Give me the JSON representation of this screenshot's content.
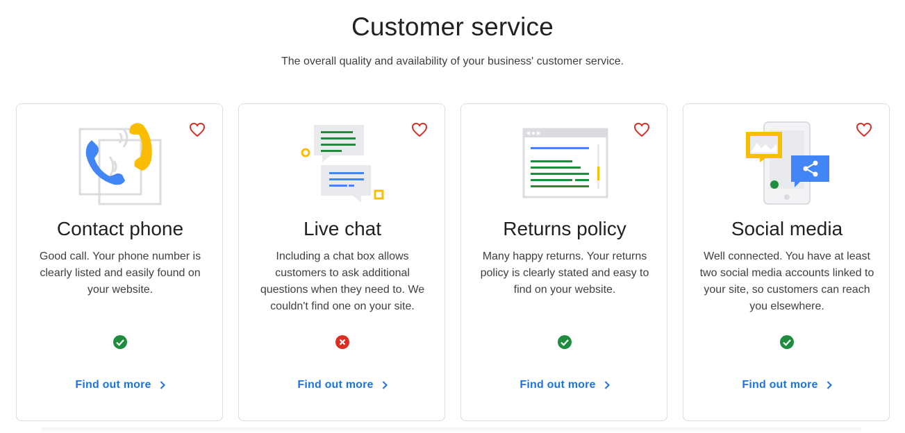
{
  "header": {
    "title": "Customer service",
    "subtitle": "The overall quality and availability of your business' customer service."
  },
  "colors": {
    "link": "#1a73e8",
    "pass": "#1e8e3e",
    "fail": "#d93025",
    "heart": "#d93025"
  },
  "cards": [
    {
      "title": "Contact phone",
      "description": "Good call. Your phone number is clearly listed and easily found on your website.",
      "status": "pass",
      "status_icon": "check-circle-icon",
      "link": "Find out more",
      "illustration": "phone-illustration"
    },
    {
      "title": "Live chat",
      "description": "Including a chat box allows customers to ask additional questions when they need to. We couldn't find one on your site.",
      "status": "fail",
      "status_icon": "x-circle-icon",
      "link": "Find out more",
      "illustration": "chat-illustration"
    },
    {
      "title": "Returns policy",
      "description": "Many happy returns. Your returns policy is clearly stated and easy to find on your website.",
      "status": "pass",
      "status_icon": "check-circle-icon",
      "link": "Find out more",
      "illustration": "returns-document-illustration"
    },
    {
      "title": "Social media",
      "description": "Well connected. You have at least two social media accounts linked to your site, so customers can reach you elsewhere.",
      "status": "pass",
      "status_icon": "check-circle-icon",
      "link": "Find out more",
      "illustration": "social-share-illustration"
    }
  ]
}
